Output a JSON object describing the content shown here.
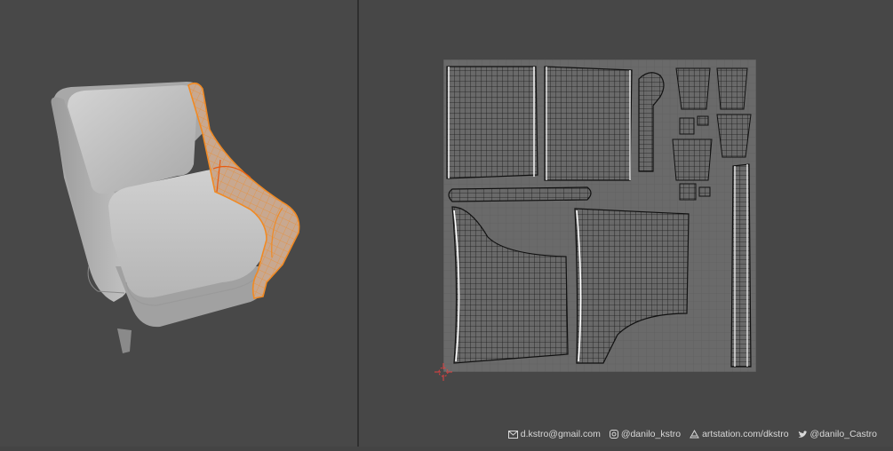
{
  "footer": {
    "email": "d.kstro@gmail.com",
    "instagram": "@danilo_kstro",
    "artstation": "artstation.com/dkstro",
    "twitter": "@danilo_Castro"
  },
  "colors": {
    "viewport_bg": "#484848",
    "uv_bg": "#474747",
    "grid_fill": "#686868",
    "selection": "#f08a24",
    "mesh_gray": "#b8b8b8"
  },
  "icons": [
    "mail-icon",
    "instagram-icon",
    "artstation-icon",
    "twitter-icon"
  ]
}
